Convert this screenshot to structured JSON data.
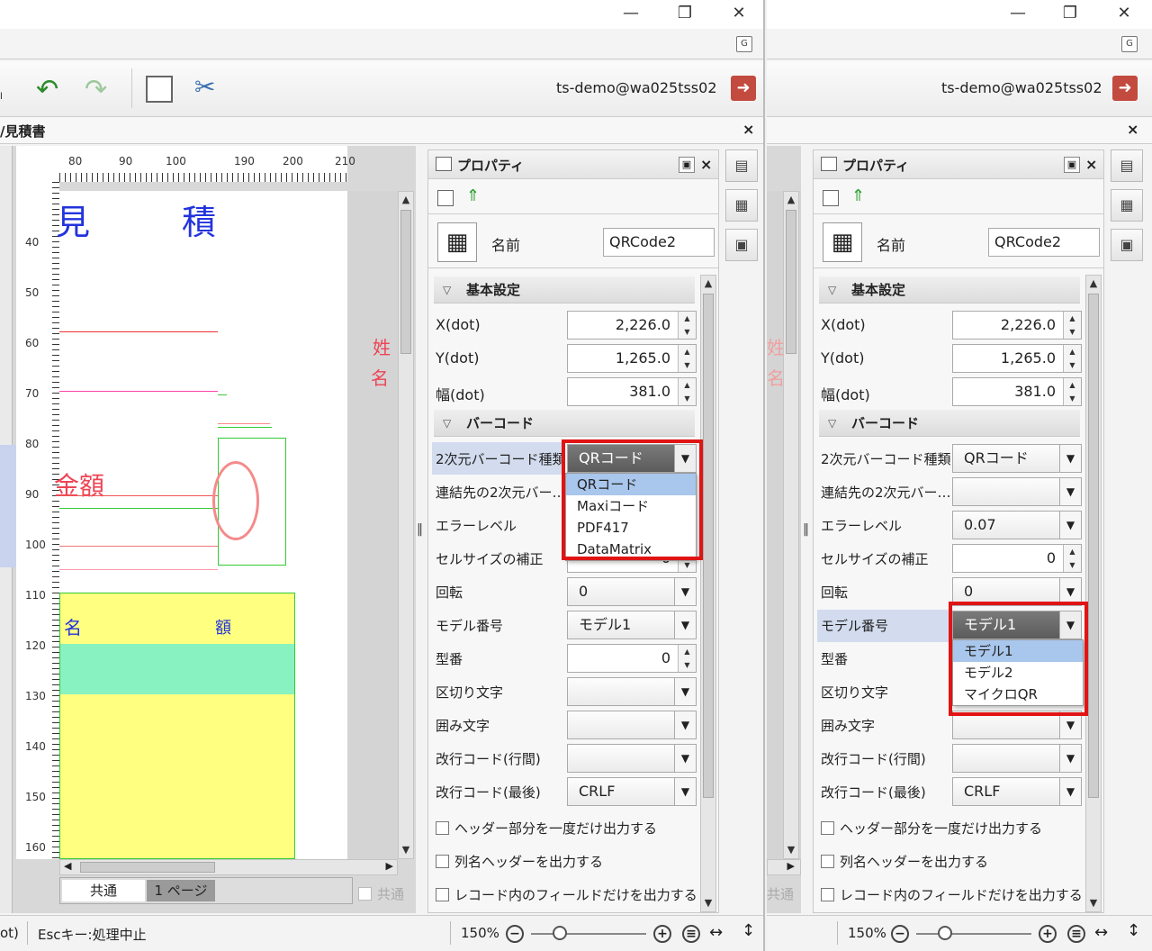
{
  "user": "ts-demo@wa025tss02",
  "tab_title": "/見積書",
  "properties": {
    "title": "プロパティ",
    "name_label": "名前",
    "name_value": "QRCode2",
    "section_basic": "基本設定",
    "section_barcode": "バーコード",
    "x_label": "X(dot)",
    "x_value": "2,226.0",
    "y_label": "Y(dot)",
    "y_value": "1,265.0",
    "w_label": "幅(dot)",
    "w_value": "381.0",
    "barcode_type_label": "2次元バーコード種類",
    "barcode_type_value": "QRコード",
    "link_label": "連結先の2次元バー…",
    "error_label": "エラーレベル",
    "error_value": "0.07",
    "cellsize_label": "セルサイズの補正",
    "cellsize_value": "0",
    "rotation_label": "回転",
    "rotation_value": "0",
    "model_label": "モデル番号",
    "model_value": "モデル1",
    "typeno_label": "型番",
    "typeno_value": "0",
    "sep_label": "区切り文字",
    "enclose_label": "囲み文字",
    "newline_mid_label": "改行コード(行間)",
    "newline_last_label": "改行コード(最後)",
    "newline_last_value": "CRLF",
    "chk_header_once": "ヘッダー部分を一度だけ出力する",
    "chk_colname_header": "列名ヘッダーを出力する",
    "chk_fields_only": "レコード内のフィールドだけを出力する"
  },
  "barcode_type_options": [
    "QRコード",
    "Maxiコード",
    "PDF417",
    "DataMatrix"
  ],
  "model_options": [
    "モデル1",
    "モデル2",
    "マイクロQR"
  ],
  "canvas": {
    "ruler_top": [
      "80",
      "90",
      "100",
      "190",
      "200",
      "210"
    ],
    "ruler_left": [
      "40",
      "50",
      "60",
      "70",
      "80",
      "90",
      "100",
      "110",
      "120",
      "130",
      "140",
      "150",
      "160"
    ],
    "text_mitsu": "見",
    "text_seki": "積",
    "text_kingaku": "金額",
    "text_mei": "名",
    "text_gaku": "額",
    "text_sei": "姓",
    "text_mei2": "名",
    "tab_common": "共通",
    "tab_page1": "1 ページ",
    "common_check": "共通"
  },
  "status": {
    "left_fragment": "ot)",
    "esc_hint": "Escキー:処理中止",
    "zoom": "150%"
  },
  "colors": {
    "accent_red": "#e01414",
    "selection_blue": "#a9c6ec"
  }
}
